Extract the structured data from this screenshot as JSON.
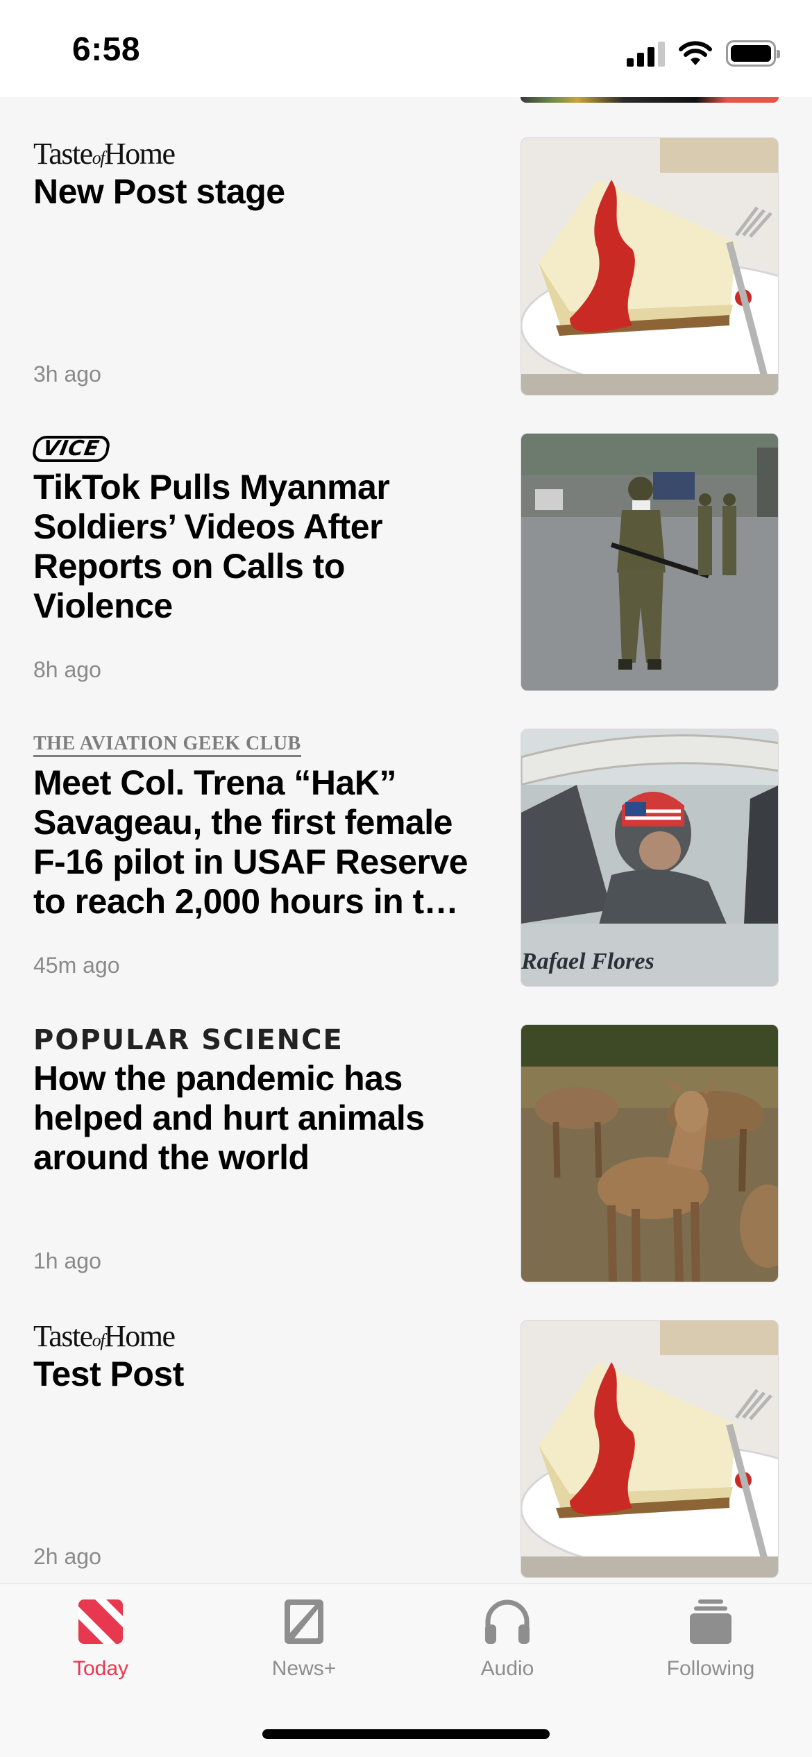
{
  "status_bar": {
    "time": "6:58",
    "signal": "signal-icon",
    "wifi": "wifi-icon",
    "battery": "battery-icon"
  },
  "articles": [
    {
      "publisher": "Taste of Home",
      "headline": "New Post stage",
      "age": "3h ago",
      "image": "cheesecake-image"
    },
    {
      "publisher": "VICE",
      "headline": "TikTok Pulls Myanmar Soldiers’ Videos After Reports on Calls to Violence",
      "age": "8h ago",
      "image": "soldier-image"
    },
    {
      "publisher": "THE AVIATION GEEK CLUB",
      "headline": "Meet Col. Trena “HaK” Savageau, the first female F-16 pilot in USAF Reserve to reach 2,000 hours in t…",
      "age": "45m ago",
      "image": "f16-pilot-image"
    },
    {
      "publisher": "POPULAR SCIENCE",
      "headline": "How the pandemic has helped and hurt animals around the world",
      "age": "1h ago",
      "image": "deer-image"
    },
    {
      "publisher": "Taste of Home",
      "headline": "Test Post",
      "age": "2h ago",
      "image": "cheesecake-image"
    }
  ],
  "publisher_logo_text": {
    "toh_a": "Taste",
    "toh_of": "of",
    "toh_b": "Home",
    "vice": "VICE",
    "agc": "THE AVIATION GEEK CLUB",
    "ps": "POPULAR SCIENCE"
  },
  "plane_text": "Rafael Flores",
  "tabs": [
    {
      "label": "Today",
      "icon": "news-logo-icon",
      "active": true
    },
    {
      "label": "News+",
      "icon": "news-plus-icon",
      "active": false
    },
    {
      "label": "Audio",
      "icon": "headphones-icon",
      "active": false
    },
    {
      "label": "Following",
      "icon": "following-stack-icon",
      "active": false
    }
  ],
  "colors": {
    "accent": "#e8384f",
    "inactive_tab": "#8e8e8e",
    "timestamp": "#8a8a8a",
    "background": "#f6f6f6"
  }
}
